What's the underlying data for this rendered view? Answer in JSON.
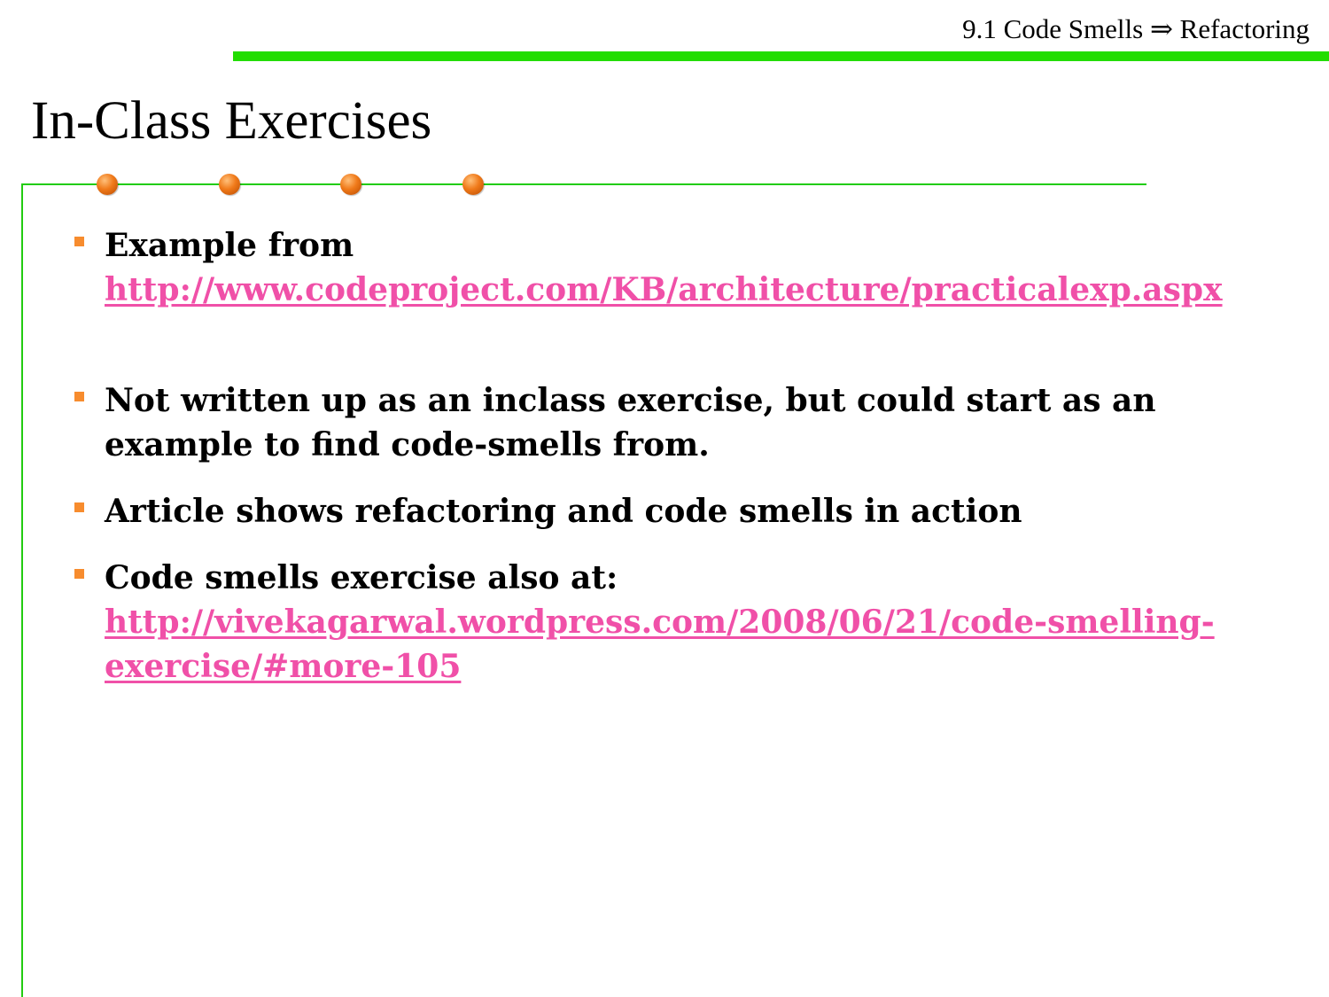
{
  "header": {
    "section_label": "9.1 Code Smells ⇒ Refactoring"
  },
  "slide": {
    "title": "In-Class Exercises"
  },
  "colors": {
    "accent_green": "#22dd00",
    "bullet_orange": "#f78c2e",
    "link_pink": "#f050a8"
  },
  "bullets": [
    {
      "text": "Example from",
      "link": "http://www.codeproject.com/KB/architecture/practicalexp.aspx"
    },
    {
      "text": "Not written up as an inclass exercise, but could start as an example to find code-smells from."
    },
    {
      "text": "Article shows refactoring and code smells in action"
    },
    {
      "text": "Code smells exercise also at:",
      "link": "http://vivekagarwal.wordpress.com/2008/06/21/code-smelling-exercise/#more-105"
    }
  ]
}
